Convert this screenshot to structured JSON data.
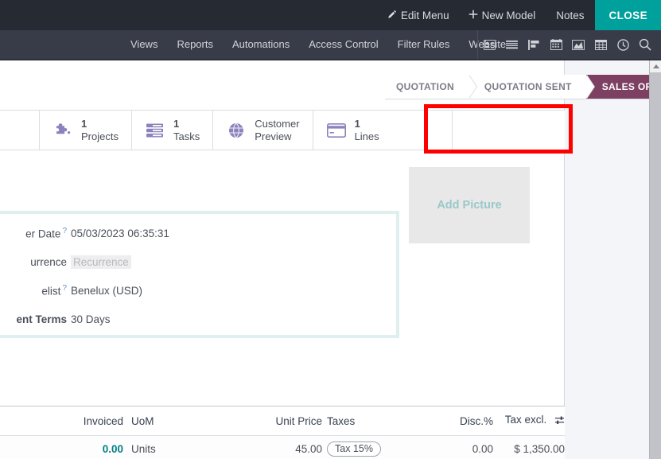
{
  "topbar": {
    "items": [
      {
        "label": "Edit Menu",
        "icon": "pencil-icon"
      },
      {
        "label": "New Model",
        "icon": "plus-icon"
      },
      {
        "label": "Notes",
        "icon": null
      }
    ],
    "close_label": "CLOSE",
    "close_color": "#00a09d",
    "background": "#252a33"
  },
  "menubar": {
    "background": "#383c48",
    "items": [
      {
        "label": "Views"
      },
      {
        "label": "Reports"
      },
      {
        "label": "Automations"
      },
      {
        "label": "Access Control"
      },
      {
        "label": "Filter Rules"
      },
      {
        "label": "Website"
      }
    ],
    "view_icons": [
      "kanban-card-icon",
      "list-view-icon",
      "bar-chart-horizontal-icon",
      "calendar-icon",
      "graph-area-icon",
      "pivot-grid-icon",
      "clock-activity-icon",
      "search-icon"
    ]
  },
  "statusbar": {
    "steps": [
      {
        "label": "QUOTATION",
        "active": false
      },
      {
        "label": "QUOTATION SENT",
        "active": false
      },
      {
        "label": "SALES ORDER",
        "active": true
      }
    ],
    "active_color": "#7d3f62"
  },
  "stat_buttons": [
    {
      "value": "1",
      "label": "Projects",
      "icon": "puzzle-piece-icon",
      "highlighted": false
    },
    {
      "value": "1",
      "label": "Tasks",
      "icon": "tasks-list-icon",
      "highlighted": false
    },
    {
      "value": "",
      "label": "Customer Preview",
      "label_line1": "Customer",
      "label_line2": "Preview",
      "icon": "globe-icon",
      "highlighted": false
    },
    {
      "value": "1",
      "label": "Lines",
      "icon": "credit-card-icon",
      "highlighted": true
    }
  ],
  "highlight": {
    "color": "#ff0000"
  },
  "picture": {
    "label": "Add Picture"
  },
  "form": {
    "fields": [
      {
        "label": "er Date",
        "help": true,
        "value": "05/03/2023 06:35:31",
        "is_placeholder": false
      },
      {
        "label": "urrence",
        "help": false,
        "value": "Recurrence",
        "is_placeholder": true
      },
      {
        "label": "elist",
        "help": true,
        "value": "Benelux (USD)",
        "is_placeholder": false
      },
      {
        "label": "ent Terms",
        "help": false,
        "value": "30 Days",
        "is_placeholder": false,
        "bold": true
      }
    ]
  },
  "lines_table": {
    "headers": {
      "invoiced": "Invoiced",
      "uom": "UoM",
      "unit_price": "Unit Price",
      "taxes": "Taxes",
      "discount": "Disc.%",
      "tax_excl": "Tax excl.",
      "options_icon": "column-options-icon"
    },
    "rows": [
      {
        "invoiced": "0.00",
        "uom": "Units",
        "unit_price": "45.00",
        "taxes": "Tax 15%",
        "discount": "0.00",
        "tax_excl": "$ 1,350.00"
      }
    ]
  },
  "scrollbar": {
    "arrow_icon": "scroll-up-arrow-icon"
  }
}
